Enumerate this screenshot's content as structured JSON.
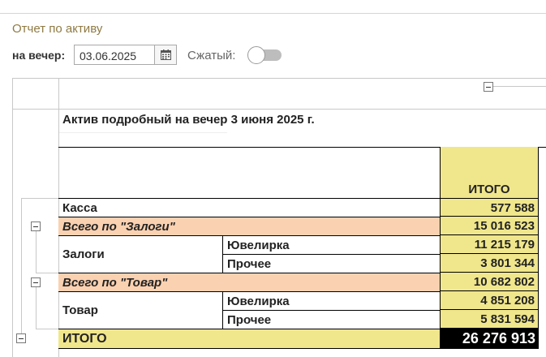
{
  "header": {
    "title": "Отчет по активу",
    "date_label": "на вечер:",
    "date_value": "03.06.2025",
    "compact_label": "Сжатый:",
    "compact_on": false
  },
  "report": {
    "title": "Актив подробный на вечер 3 июня 2025 г.",
    "total_column": "ИТОГО",
    "rows": {
      "kassa": {
        "label": "Касса",
        "value": "577 588"
      },
      "zalogi_total": {
        "label": "Всего по \"Залоги\"",
        "value": "15 016 523"
      },
      "zalogi_group": "Залоги",
      "zalogi_jew": {
        "label": "Ювелирка",
        "value": "11 215 179"
      },
      "zalogi_other": {
        "label": "Прочее",
        "value": "3 801 344"
      },
      "tovar_total": {
        "label": "Всего по \"Товар\"",
        "value": "10 682 802"
      },
      "tovar_group": "Товар",
      "tovar_jew": {
        "label": "Ювелирка",
        "value": "4 851 208"
      },
      "tovar_other": {
        "label": "Прочее",
        "value": "5 831 594"
      },
      "grand_total": {
        "label": "ИТОГО",
        "value": "26 276 913"
      }
    }
  },
  "colors": {
    "total_col": "#f0e68c",
    "subtotal_row": "#fad1b1",
    "grand_total_value_bg": "#000000"
  },
  "icons": [
    "calendar-icon",
    "collapse-icon"
  ]
}
